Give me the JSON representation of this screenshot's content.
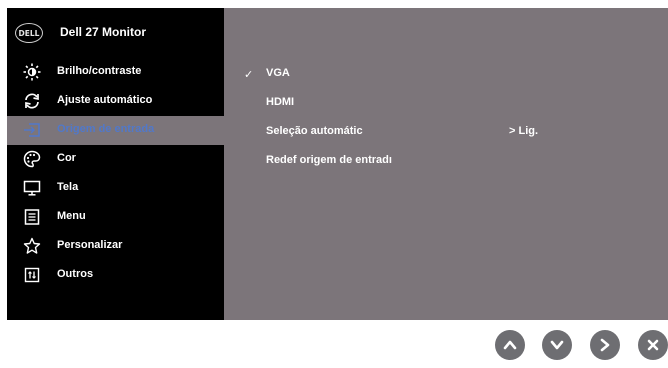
{
  "header": {
    "logo_text": "DELL",
    "title": "Dell 27 Monitor"
  },
  "menu": {
    "items": [
      {
        "label": "Brilho/contraste",
        "icon": "brightness-icon"
      },
      {
        "label": "Ajuste automático",
        "icon": "auto-adjust-icon"
      },
      {
        "label": "Origem de entrada",
        "icon": "input-source-icon",
        "active": true
      },
      {
        "label": "Cor",
        "icon": "color-palette-icon"
      },
      {
        "label": "Tela",
        "icon": "display-icon"
      },
      {
        "label": "Menu",
        "icon": "menu-list-icon"
      },
      {
        "label": "Personalizar",
        "icon": "star-icon"
      },
      {
        "label": "Outros",
        "icon": "others-icon"
      }
    ]
  },
  "submenu": {
    "options": [
      {
        "label": "VGA",
        "selected": true
      },
      {
        "label": "HDMI"
      },
      {
        "label": "Seleção automátic",
        "value": "> Lig."
      },
      {
        "label": "Redef origem de entradı"
      }
    ],
    "check_mark": "✓"
  },
  "buttons": [
    "up-button",
    "down-button",
    "enter-button",
    "exit-button"
  ],
  "colors": {
    "left_panel": "#000000",
    "right_panel": "#7c757a",
    "active_text": "#5178c9",
    "button": "#6e6e72"
  }
}
